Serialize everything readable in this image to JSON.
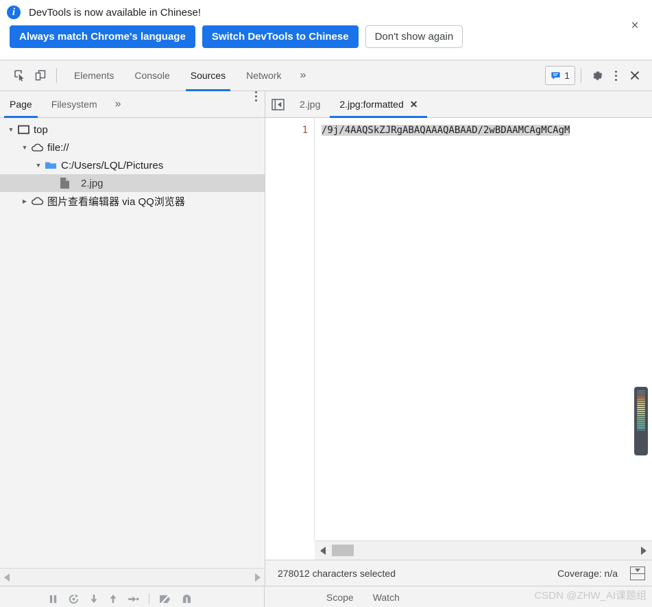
{
  "infobar": {
    "icon": "info-icon",
    "message": "DevTools is now available in Chinese!",
    "buttons": {
      "always_match": "Always match Chrome's language",
      "switch": "Switch DevTools to Chinese",
      "dont_show": "Don't show again"
    },
    "close_label": "×"
  },
  "toolbar": {
    "inspect_icon": "inspect-element-icon",
    "device_icon": "device-toolbar-icon",
    "tabs": [
      {
        "label": "Elements",
        "active": false
      },
      {
        "label": "Console",
        "active": false
      },
      {
        "label": "Sources",
        "active": true
      },
      {
        "label": "Network",
        "active": false
      }
    ],
    "more_tabs": "»",
    "issues_count": "1",
    "issues_icon": "issues-message-icon",
    "settings_icon": "gear-icon",
    "menu_icon": "kebab-menu-icon",
    "close_icon": "close-icon",
    "accent": "#1a73e8"
  },
  "navigator": {
    "tabs": [
      {
        "label": "Page",
        "active": true
      },
      {
        "label": "Filesystem",
        "active": false
      }
    ],
    "more_tabs": "»",
    "menu_icon": "kebab-menu-icon",
    "tree": [
      {
        "label": "top",
        "icon": "frame-icon",
        "twisty": "▼",
        "depth": 0,
        "selected": false
      },
      {
        "label": "file://",
        "icon": "cloud-icon",
        "twisty": "▼",
        "depth": 1,
        "selected": false
      },
      {
        "label": "C:/Users/LQL/Pictures",
        "icon": "folder-icon",
        "twisty": "▼",
        "depth": 2,
        "selected": false
      },
      {
        "label": "2.jpg",
        "icon": "file-icon",
        "twisty": "",
        "depth": 3,
        "selected": true
      },
      {
        "label": "图片查看编辑器 via QQ浏览器",
        "icon": "cloud-icon",
        "twisty": "▶",
        "depth": 1,
        "selected": false
      }
    ],
    "scroll_left": "scroll-left-arrow",
    "scroll_right": "scroll-right-arrow"
  },
  "editor": {
    "nav_toggle_icon": "show-navigator-icon",
    "tabs": [
      {
        "label": "2.jpg",
        "active": false,
        "closable": false
      },
      {
        "label": "2.jpg:formatted",
        "active": true,
        "closable": true,
        "close": "✕"
      }
    ],
    "line_number": "1",
    "code_line": "/9j/4AAQSkZJRgABAQAAAQABAAD/2wBDAAMCAgMCAgM",
    "minimap_name": "code-overview-ruler",
    "minimap_colors": [
      "#6e7480",
      "#6e7480",
      "#6e7480",
      "#c96a3c",
      "#d88a3a",
      "#e0a23c",
      "#e3b53f",
      "#e6c543",
      "#dfd049",
      "#cfd24e",
      "#b9cf55",
      "#a2cb5e",
      "#8ac767",
      "#78c474",
      "#6cc183",
      "#62be93",
      "#5dbca3",
      "#59bab0",
      "#56b9bd",
      "#6e7480"
    ],
    "h_scroll_left": "scroll-left-arrow",
    "h_scroll_right": "scroll-right-arrow"
  },
  "status": {
    "selection_text": "278012 characters selected",
    "coverage_text": "Coverage: n/a",
    "drawer_icon": "show-drawer-icon"
  },
  "debugger": {
    "icons": [
      "pause-script-icon",
      "step-over-icon",
      "step-into-icon",
      "step-out-icon",
      "step-icon",
      "deactivate-breakpoints-icon",
      "pause-on-exceptions-icon"
    ],
    "scope_tabs": [
      "Scope",
      "Watch"
    ]
  },
  "watermark": {
    "text": "CSDN @ZHW_AI课题组"
  }
}
